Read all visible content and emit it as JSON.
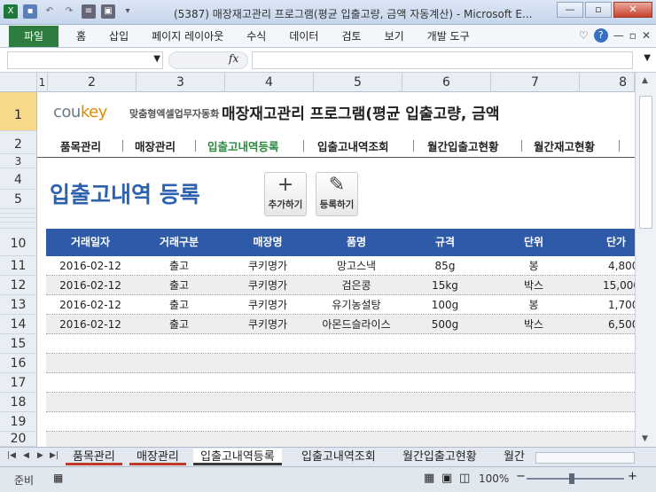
{
  "window": {
    "title": "(5387) 매장재고관리 프로그램(평균 입출고량, 금액 자동계산) - Microsoft E...",
    "app_color": "#1f7a3a"
  },
  "ribbon": {
    "file_tab": "파일",
    "tabs": [
      "홈",
      "삽입",
      "페이지 레이아웃",
      "수식",
      "데이터",
      "검토",
      "보기",
      "개발 도구"
    ]
  },
  "formula_bar": {
    "fx_label": "fx",
    "cell_value": ""
  },
  "columns": [
    "1",
    "2",
    "3",
    "4",
    "5",
    "6",
    "7",
    "8"
  ],
  "rows": [
    "1",
    "2",
    "3",
    "4",
    "5",
    "6",
    "7",
    "8",
    "9",
    "10",
    "11",
    "12",
    "13",
    "14",
    "15",
    "16",
    "17",
    "18",
    "19",
    "20"
  ],
  "header": {
    "brand_main": "cou",
    "brand_accent": "key",
    "brand_sub": "맞춤형엑셀업무자동화",
    "title": "매장재고관리 프로그램(평균 입출고량, 금액"
  },
  "nav": {
    "items": [
      "품목관리",
      "매장관리",
      "입출고내역등록",
      "입출고내역조회",
      "월간입출고현황",
      "월간재고현황"
    ],
    "active": "입출고내역등록"
  },
  "page": {
    "title": "입출고내역 등록",
    "add_label": "추가하기",
    "register_label": "등록하기"
  },
  "table": {
    "headers": [
      "거래일자",
      "거래구분",
      "매장명",
      "품명",
      "규격",
      "단위",
      "단가"
    ],
    "rows": [
      [
        "2016-02-12",
        "출고",
        "쿠키명가",
        "망고스낵",
        "85g",
        "봉",
        "4,800"
      ],
      [
        "2016-02-12",
        "출고",
        "쿠키명가",
        "검은콩",
        "15kg",
        "박스",
        "15,000"
      ],
      [
        "2016-02-12",
        "출고",
        "쿠키명가",
        "유기농설탕",
        "100g",
        "봉",
        "1,700"
      ],
      [
        "2016-02-12",
        "출고",
        "쿠키명가",
        "아몬드슬라이스",
        "500g",
        "박스",
        "6,500"
      ]
    ],
    "header_color": "#2f5aa8"
  },
  "sheet_tabs": [
    "품목관리",
    "매장관리",
    "입출고내역등록",
    "입출고내역조회",
    "월간입출고현황",
    "월간"
  ],
  "status": {
    "ready": "준비",
    "zoom": "100%"
  },
  "colors": {
    "accent_green": "#2b8a3e",
    "title_blue": "#2d62b0",
    "brand_orange": "#e08a00"
  }
}
